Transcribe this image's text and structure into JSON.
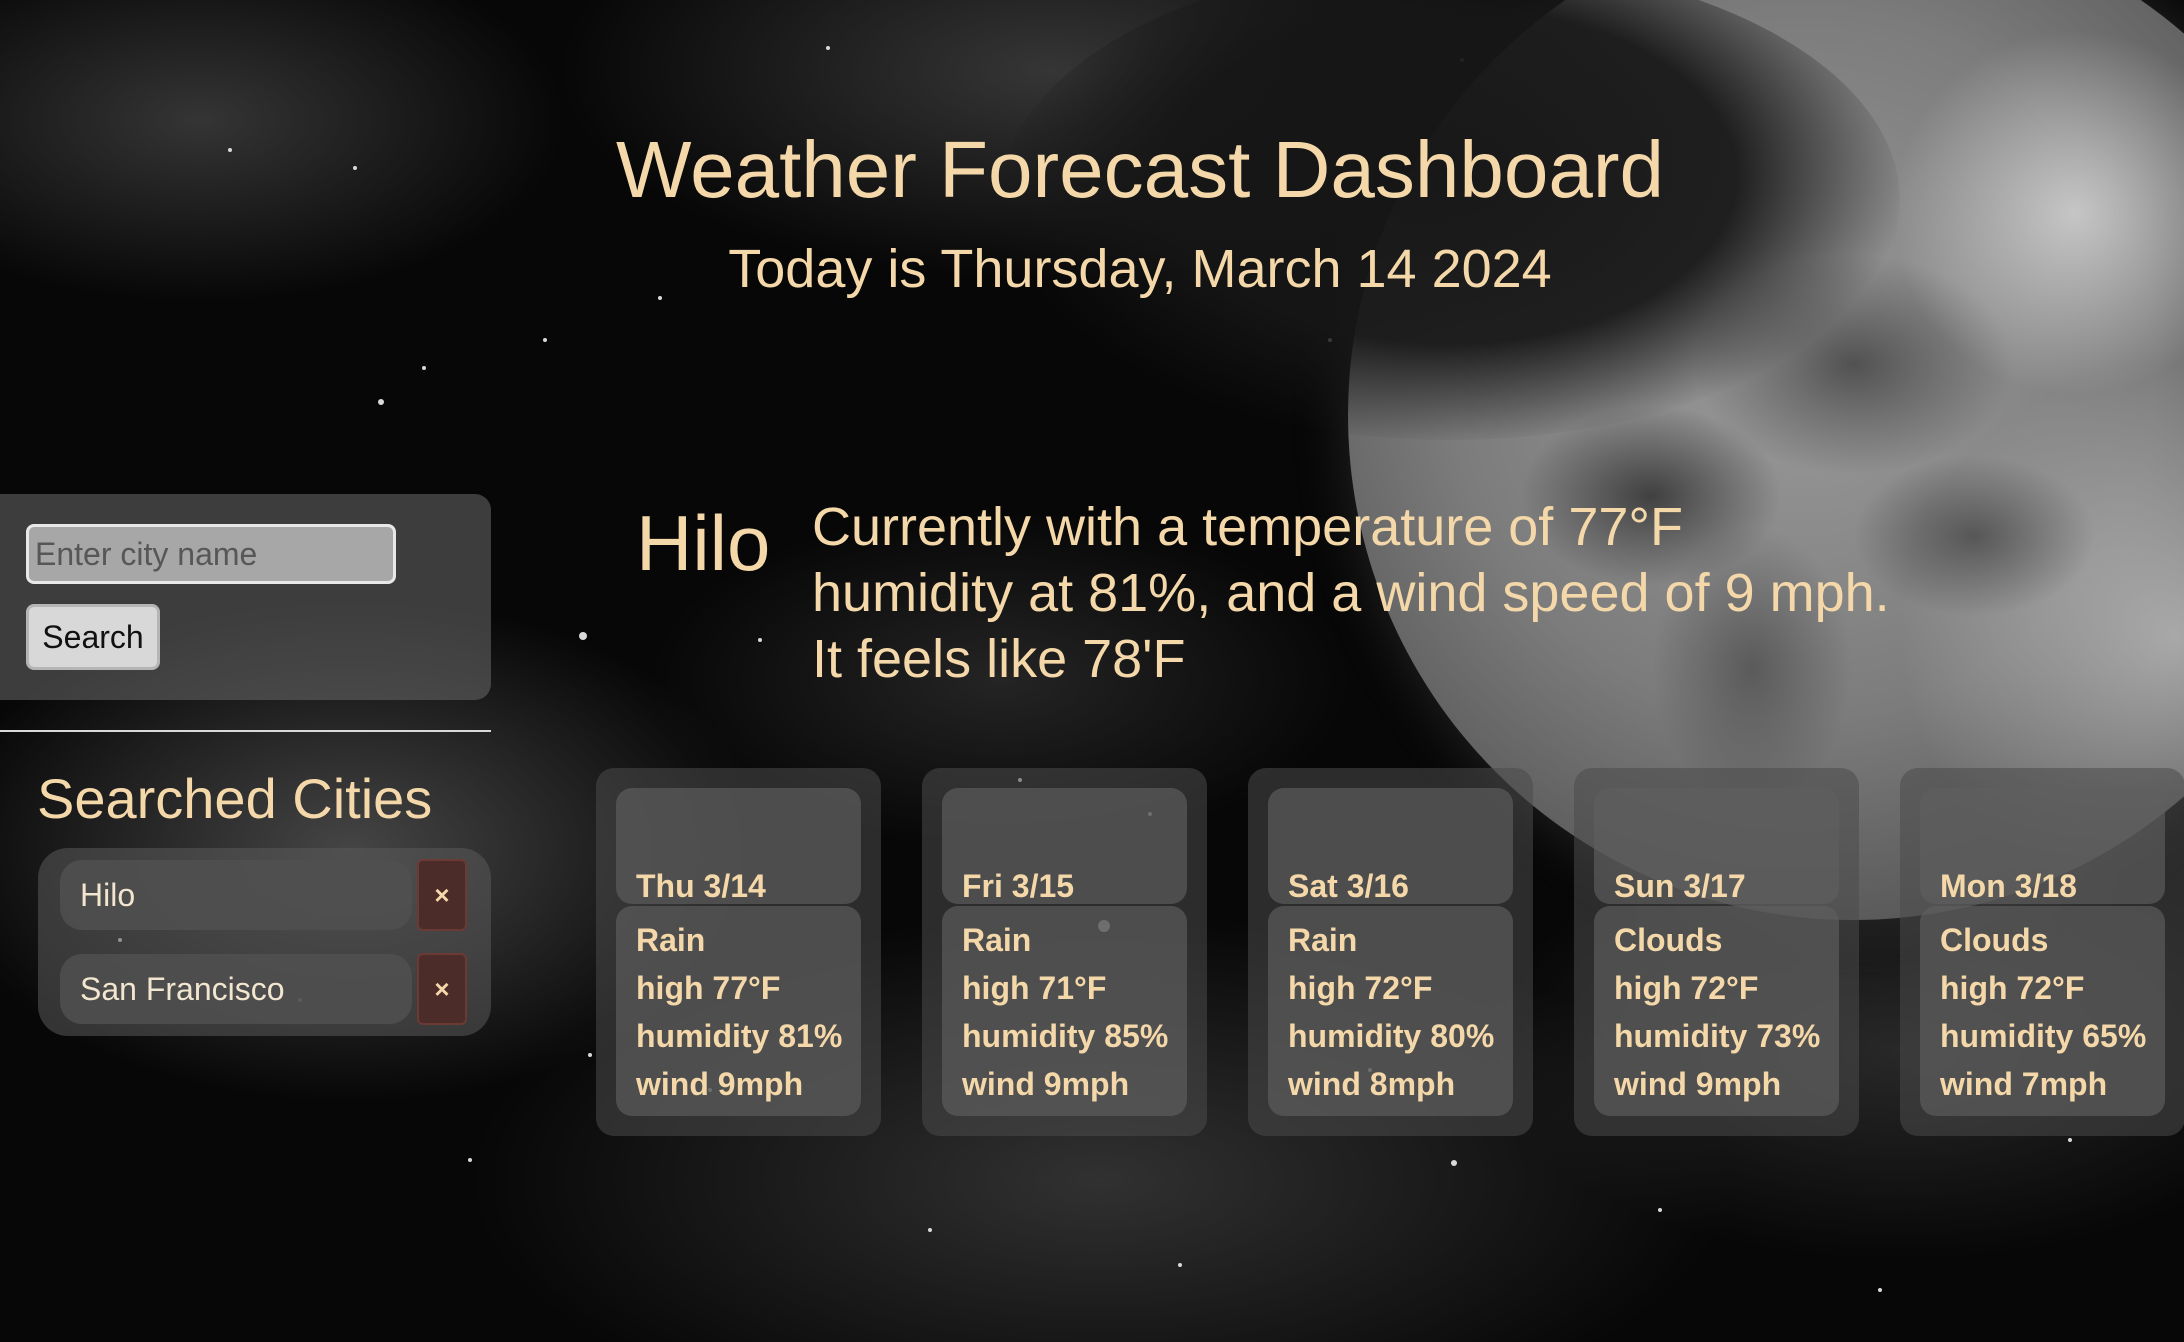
{
  "header": {
    "title": "Weather Forecast Dashboard",
    "date_line": "Today is Thursday, March 14 2024"
  },
  "search": {
    "placeholder": "Enter city name",
    "value": "",
    "button_label": "Search"
  },
  "history": {
    "heading": "Searched Cities",
    "cities": [
      {
        "name": "Hilo",
        "remove_label": "×"
      },
      {
        "name": "San Francisco",
        "remove_label": "×"
      }
    ]
  },
  "current": {
    "city": "Hilo",
    "line1": "Currently with a temperature of 77°F",
    "line2": "humidity at 81%, and a wind speed of 9 mph.",
    "line3": "It feels like 78'F"
  },
  "forecast": [
    {
      "day": "Thu 3/14",
      "condition": "Rain",
      "high": "high 77°F",
      "humidity": "humidity 81%",
      "wind": "wind 9mph"
    },
    {
      "day": "Fri 3/15",
      "condition": "Rain",
      "high": "high 71°F",
      "humidity": "humidity 85%",
      "wind": "wind 9mph"
    },
    {
      "day": "Sat 3/16",
      "condition": "Rain",
      "high": "high 72°F",
      "humidity": "humidity 80%",
      "wind": "wind 8mph"
    },
    {
      "day": "Sun 3/17",
      "condition": "Clouds",
      "high": "high 72°F",
      "humidity": "humidity 73%",
      "wind": "wind 9mph"
    },
    {
      "day": "Mon 3/18",
      "condition": "Clouds",
      "high": "high 72°F",
      "humidity": "humidity 65%",
      "wind": "wind 7mph"
    }
  ],
  "colors": {
    "accent_text": "#f4d8a9",
    "remove_button": "#4c2c28"
  },
  "background": {
    "icon": "moon-night-sky-image"
  }
}
